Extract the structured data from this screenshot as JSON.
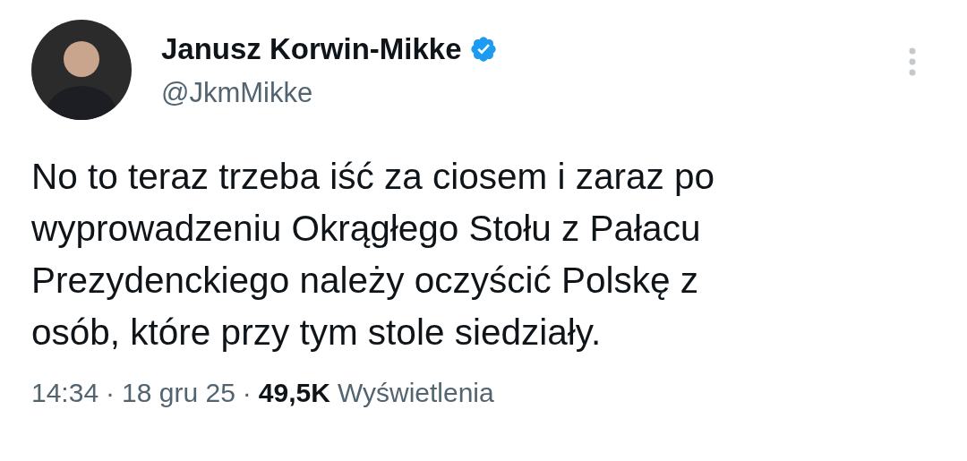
{
  "author": {
    "name": "Janusz Korwin-Mikke",
    "verified": true,
    "handle": "@JkmMikke"
  },
  "body": "No to teraz trzeba iść za ciosem i zaraz po\nwyprowadzeniu Okrągłego Stołu z Pałacu\nPrezydenckiego należy oczyścić Polskę z\nosób, które przy tym stole siedziały.",
  "footer": {
    "time": "14:34",
    "separator": "·",
    "date": "18 gru 25",
    "views": "49,5K",
    "views_label": "Wyświetlenia"
  }
}
